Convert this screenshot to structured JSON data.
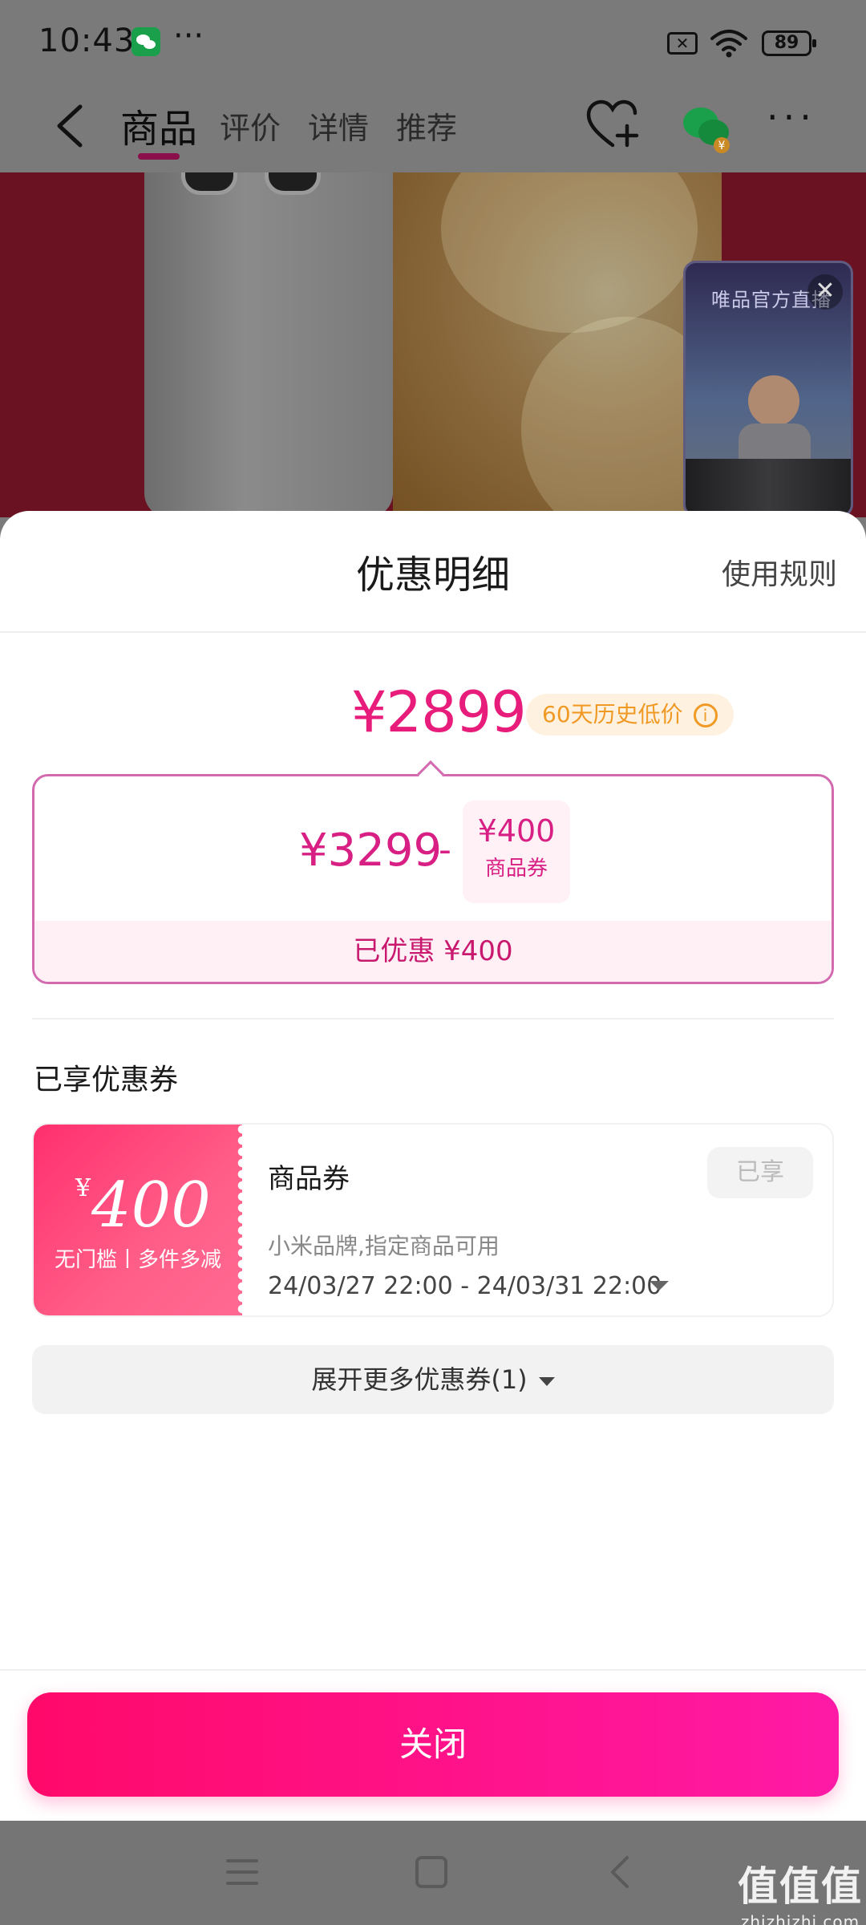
{
  "status_bar": {
    "time": "10:43",
    "dots": "···",
    "sim_icon": "sim-off-icon",
    "wifi_icon": "wifi-icon",
    "battery": "89"
  },
  "nav": {
    "tabs": [
      "商品",
      "评价",
      "详情",
      "推荐"
    ],
    "active_tab": "商品",
    "icons": [
      "back-arrow-icon",
      "favorite-heart-plus-icon",
      "wechat-share-icon",
      "more-icon"
    ],
    "more": "···"
  },
  "live_widget": {
    "title": "唯品官方直播",
    "close": "✕"
  },
  "sheet": {
    "title": "优惠明细",
    "rules_link": "使用规则",
    "final_price": "¥2899",
    "low_price_badge": "60天历史低价",
    "info_icon": "i",
    "original_price": "¥3299",
    "minus": "-",
    "coupon_chip_amount": "¥400",
    "coupon_chip_label": "商品券",
    "saved_text": "已优惠 ¥400",
    "section_title": "已享优惠券",
    "coupon": {
      "currency": "¥",
      "amount": "400",
      "tag": "无门槛丨多件多减",
      "name": "商品券",
      "scope": "小米品牌,指定商品可用",
      "validity": "24/03/27 22:00 - 24/03/31 22:00",
      "status": "已享"
    },
    "expand_more": "展开更多优惠券(1)",
    "close_button": "关闭"
  },
  "watermark": {
    "main": "值值值",
    "sub": "zhizhizhi.com"
  },
  "colors": {
    "accent": "#e81c7a",
    "badge_text": "#f09a26",
    "close_gradient_start": "#ff0a6a",
    "close_gradient_end": "#ff1aa6"
  }
}
